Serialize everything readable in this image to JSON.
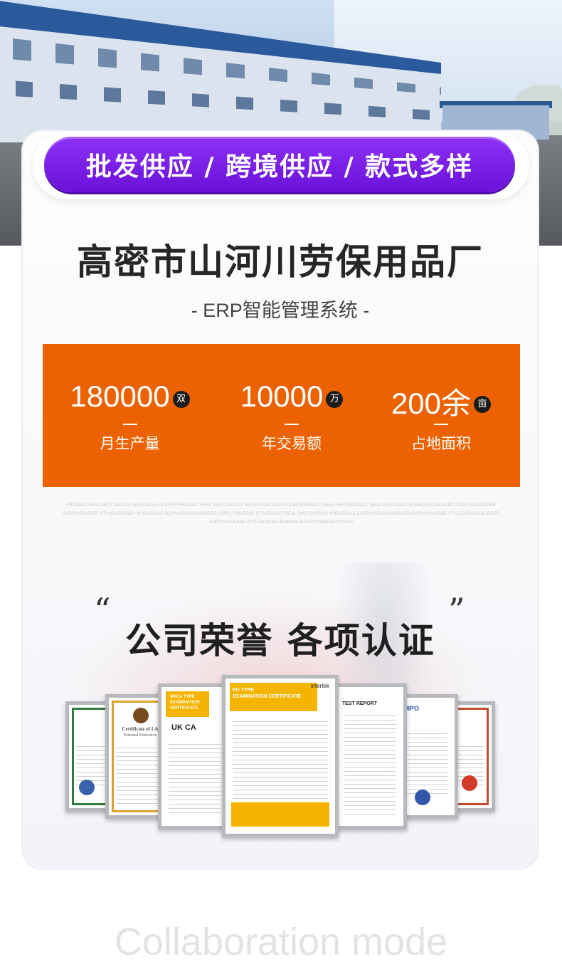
{
  "banner": {
    "text": "批发供应 / 跨境供应 / 款式多样"
  },
  "company": {
    "name": "高密市山河川劳保用品厂",
    "subtitle": "- ERP智能管理系统 -"
  },
  "stats": [
    {
      "value": "180000",
      "unit": "双",
      "label": "月生产量"
    },
    {
      "value": "10000",
      "unit": "万",
      "label": "年交易额"
    },
    {
      "value": "200余",
      "unit": "亩",
      "label": "占地面积"
    }
  ],
  "tiny_text": "PRODUCT REAL SHOT DISPLAY WHOLESALE SUPPLY/PRODUCT REAL SHOT DISPLAY WHOLESALE SUPPLY/CRPRPRODUCT REAL SHOTPRODUCT REAL SHOT DISPLAY WHOLESALE SUPPLY/CR OSS-BORDER SUPPLY/DIVERSE STYLES DISPLAY WHOLESALE SUPPLY/CROSS-BORDER SUPPLY/DIVERSE STYLESDUCT REAL SHOT DISPLAY WHOLESALE SUPPLY/CROSS-BORDER SUPPLY/DIVERSE STYLESCROSS-BORDER SUPPLY/DIVERSE STYLESCROSS-BORDER SUPPLY/DIVERSE STYLES",
  "honors": {
    "title": "公司荣誉 各项认证",
    "quote_open": "“",
    "quote_close": "”"
  },
  "certificates": {
    "eu_type": "EU TYPE",
    "eu_sub": "EXAMINATION CERTIFICATE",
    "eu_logo": "intertek",
    "ukca_type": "UKCA TYPE",
    "ukca_sub": "EXAMINATION CERTIFICATE",
    "ukca_mark": "UK CA",
    "la_head": "Certificate of LA",
    "la_sub": "Personal Protective",
    "test_report": "TEST REPORT",
    "euipo": "EUIPO"
  },
  "footer": {
    "collab": "Collaboration mode"
  },
  "colors": {
    "banner": "#7a1fe6",
    "stats_bg": "#ec6200",
    "text_dark": "#262626"
  }
}
